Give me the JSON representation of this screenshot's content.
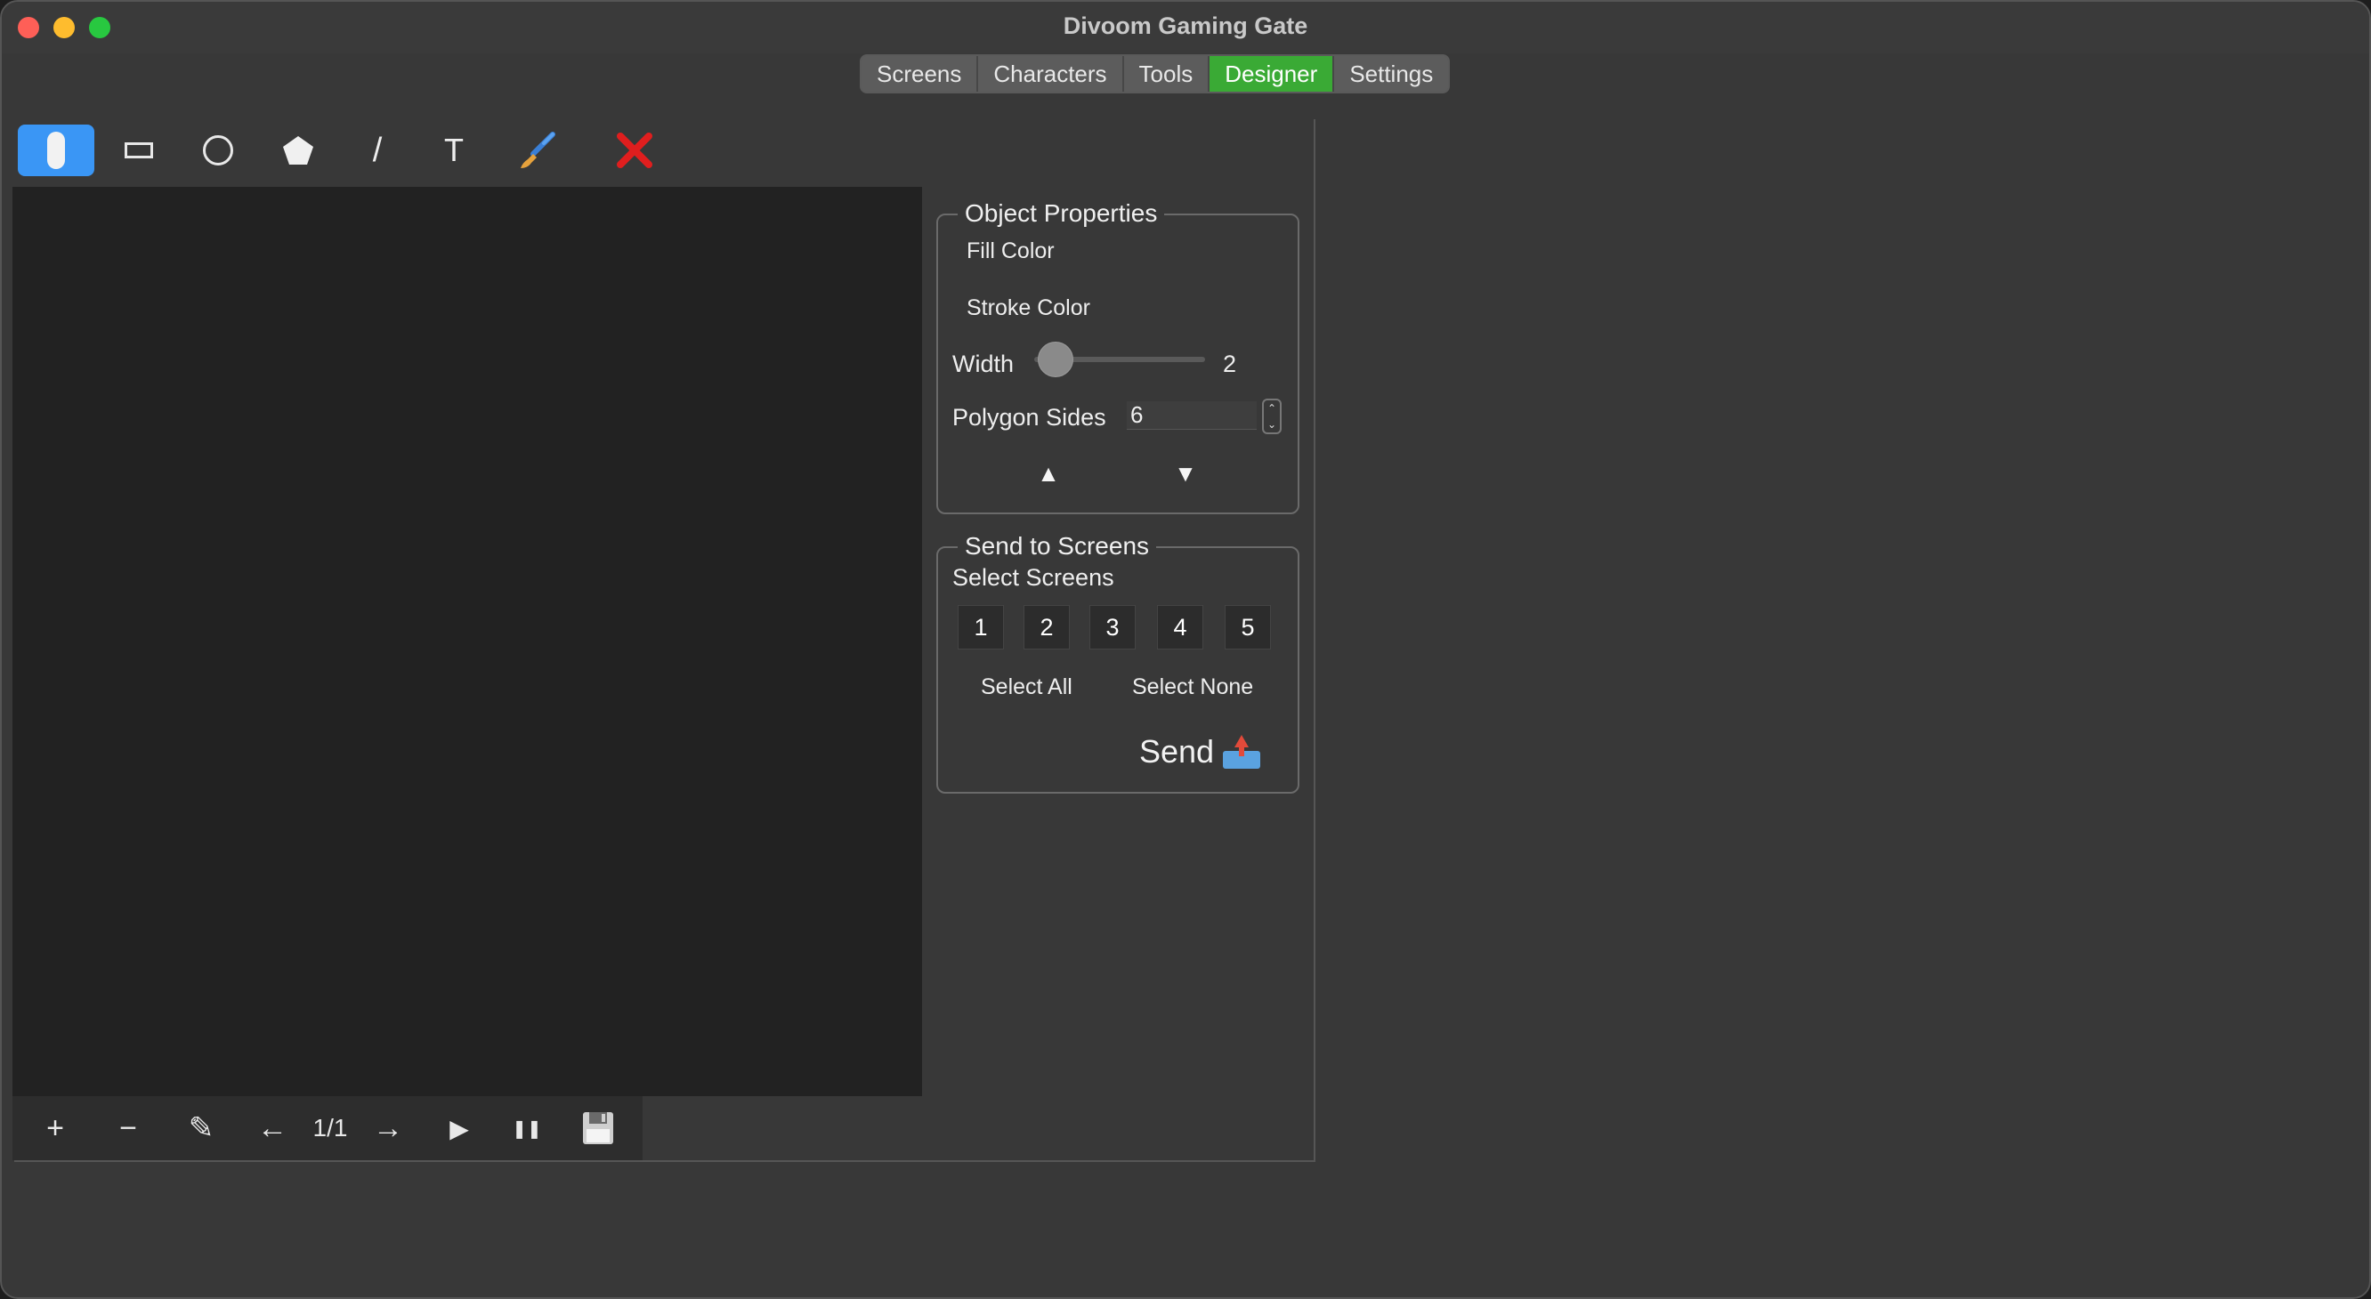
{
  "window": {
    "title": "Divoom Gaming Gate"
  },
  "tabs": [
    {
      "label": "Screens"
    },
    {
      "label": "Characters"
    },
    {
      "label": "Tools"
    },
    {
      "label": "Designer",
      "active": true
    },
    {
      "label": "Settings"
    }
  ],
  "toolbar": {
    "tools": [
      {
        "name": "select-tool",
        "icon": "pointer-icon",
        "active": true
      },
      {
        "name": "rectangle-tool",
        "icon": "rectangle-icon"
      },
      {
        "name": "circle-tool",
        "icon": "circle-icon"
      },
      {
        "name": "polygon-tool",
        "icon": "pentagon-icon"
      },
      {
        "name": "line-tool",
        "icon": "line-icon"
      },
      {
        "name": "text-tool",
        "icon": "text-icon"
      },
      {
        "name": "brush-tool",
        "icon": "paintbrush-icon"
      },
      {
        "name": "delete-tool",
        "icon": "red-x-icon"
      }
    ],
    "text_tool_glyph": "T",
    "line_tool_glyph": "/",
    "delete_glyph": "✕"
  },
  "object_properties": {
    "title": "Object Properties",
    "fill_color_label": "Fill Color",
    "stroke_color_label": "Stroke Color",
    "width_label": "Width",
    "width_value": "2",
    "polygon_sides_label": "Polygon Sides",
    "polygon_sides_value": "6",
    "move_up_glyph": "▲",
    "move_down_glyph": "▼"
  },
  "send_to_screens": {
    "title": "Send to Screens",
    "select_label": "Select Screens",
    "screens": [
      "1",
      "2",
      "3",
      "4",
      "5"
    ],
    "select_all_label": "Select All",
    "select_none_label": "Select None",
    "send_label": "Send"
  },
  "bottom_bar": {
    "add_glyph": "+",
    "remove_glyph": "−",
    "edit_glyph": "✎",
    "prev_glyph": "←",
    "frame_counter": "1/1",
    "next_glyph": "→",
    "play_glyph": "▶",
    "pause_glyph": "❚❚",
    "save_icon": "floppy-disk-icon"
  },
  "colors": {
    "accent_tab": "#3aaa35",
    "selected_tool": "#3a96f5",
    "delete_red": "#e01e1e",
    "window_bg": "#383838",
    "canvas_bg": "#222222"
  }
}
